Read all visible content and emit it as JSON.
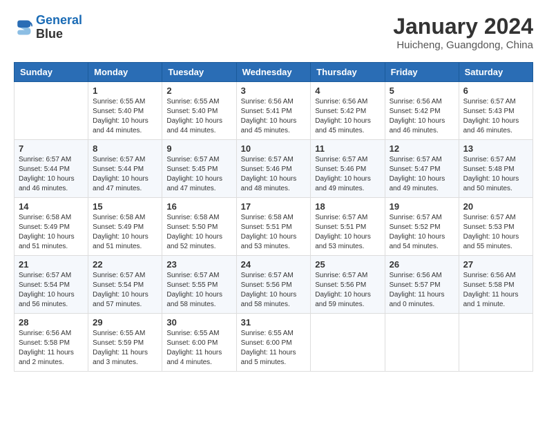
{
  "header": {
    "logo_line1": "General",
    "logo_line2": "Blue",
    "month_year": "January 2024",
    "location": "Huicheng, Guangdong, China"
  },
  "days_of_week": [
    "Sunday",
    "Monday",
    "Tuesday",
    "Wednesday",
    "Thursday",
    "Friday",
    "Saturday"
  ],
  "weeks": [
    [
      {
        "day": "",
        "info": ""
      },
      {
        "day": "1",
        "info": "Sunrise: 6:55 AM\nSunset: 5:40 PM\nDaylight: 10 hours\nand 44 minutes."
      },
      {
        "day": "2",
        "info": "Sunrise: 6:55 AM\nSunset: 5:40 PM\nDaylight: 10 hours\nand 44 minutes."
      },
      {
        "day": "3",
        "info": "Sunrise: 6:56 AM\nSunset: 5:41 PM\nDaylight: 10 hours\nand 45 minutes."
      },
      {
        "day": "4",
        "info": "Sunrise: 6:56 AM\nSunset: 5:42 PM\nDaylight: 10 hours\nand 45 minutes."
      },
      {
        "day": "5",
        "info": "Sunrise: 6:56 AM\nSunset: 5:42 PM\nDaylight: 10 hours\nand 46 minutes."
      },
      {
        "day": "6",
        "info": "Sunrise: 6:57 AM\nSunset: 5:43 PM\nDaylight: 10 hours\nand 46 minutes."
      }
    ],
    [
      {
        "day": "7",
        "info": "Sunrise: 6:57 AM\nSunset: 5:44 PM\nDaylight: 10 hours\nand 46 minutes."
      },
      {
        "day": "8",
        "info": "Sunrise: 6:57 AM\nSunset: 5:44 PM\nDaylight: 10 hours\nand 47 minutes."
      },
      {
        "day": "9",
        "info": "Sunrise: 6:57 AM\nSunset: 5:45 PM\nDaylight: 10 hours\nand 47 minutes."
      },
      {
        "day": "10",
        "info": "Sunrise: 6:57 AM\nSunset: 5:46 PM\nDaylight: 10 hours\nand 48 minutes."
      },
      {
        "day": "11",
        "info": "Sunrise: 6:57 AM\nSunset: 5:46 PM\nDaylight: 10 hours\nand 49 minutes."
      },
      {
        "day": "12",
        "info": "Sunrise: 6:57 AM\nSunset: 5:47 PM\nDaylight: 10 hours\nand 49 minutes."
      },
      {
        "day": "13",
        "info": "Sunrise: 6:57 AM\nSunset: 5:48 PM\nDaylight: 10 hours\nand 50 minutes."
      }
    ],
    [
      {
        "day": "14",
        "info": "Sunrise: 6:58 AM\nSunset: 5:49 PM\nDaylight: 10 hours\nand 51 minutes."
      },
      {
        "day": "15",
        "info": "Sunrise: 6:58 AM\nSunset: 5:49 PM\nDaylight: 10 hours\nand 51 minutes."
      },
      {
        "day": "16",
        "info": "Sunrise: 6:58 AM\nSunset: 5:50 PM\nDaylight: 10 hours\nand 52 minutes."
      },
      {
        "day": "17",
        "info": "Sunrise: 6:58 AM\nSunset: 5:51 PM\nDaylight: 10 hours\nand 53 minutes."
      },
      {
        "day": "18",
        "info": "Sunrise: 6:57 AM\nSunset: 5:51 PM\nDaylight: 10 hours\nand 53 minutes."
      },
      {
        "day": "19",
        "info": "Sunrise: 6:57 AM\nSunset: 5:52 PM\nDaylight: 10 hours\nand 54 minutes."
      },
      {
        "day": "20",
        "info": "Sunrise: 6:57 AM\nSunset: 5:53 PM\nDaylight: 10 hours\nand 55 minutes."
      }
    ],
    [
      {
        "day": "21",
        "info": "Sunrise: 6:57 AM\nSunset: 5:54 PM\nDaylight: 10 hours\nand 56 minutes."
      },
      {
        "day": "22",
        "info": "Sunrise: 6:57 AM\nSunset: 5:54 PM\nDaylight: 10 hours\nand 57 minutes."
      },
      {
        "day": "23",
        "info": "Sunrise: 6:57 AM\nSunset: 5:55 PM\nDaylight: 10 hours\nand 58 minutes."
      },
      {
        "day": "24",
        "info": "Sunrise: 6:57 AM\nSunset: 5:56 PM\nDaylight: 10 hours\nand 58 minutes."
      },
      {
        "day": "25",
        "info": "Sunrise: 6:57 AM\nSunset: 5:56 PM\nDaylight: 10 hours\nand 59 minutes."
      },
      {
        "day": "26",
        "info": "Sunrise: 6:56 AM\nSunset: 5:57 PM\nDaylight: 11 hours\nand 0 minutes."
      },
      {
        "day": "27",
        "info": "Sunrise: 6:56 AM\nSunset: 5:58 PM\nDaylight: 11 hours\nand 1 minute."
      }
    ],
    [
      {
        "day": "28",
        "info": "Sunrise: 6:56 AM\nSunset: 5:58 PM\nDaylight: 11 hours\nand 2 minutes."
      },
      {
        "day": "29",
        "info": "Sunrise: 6:55 AM\nSunset: 5:59 PM\nDaylight: 11 hours\nand 3 minutes."
      },
      {
        "day": "30",
        "info": "Sunrise: 6:55 AM\nSunset: 6:00 PM\nDaylight: 11 hours\nand 4 minutes."
      },
      {
        "day": "31",
        "info": "Sunrise: 6:55 AM\nSunset: 6:00 PM\nDaylight: 11 hours\nand 5 minutes."
      },
      {
        "day": "",
        "info": ""
      },
      {
        "day": "",
        "info": ""
      },
      {
        "day": "",
        "info": ""
      }
    ]
  ]
}
